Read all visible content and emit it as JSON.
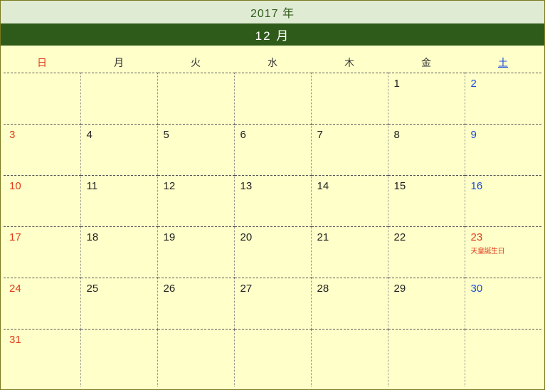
{
  "year_label": "2017 年",
  "month_label": "12 月",
  "weekdays": [
    "日",
    "月",
    "火",
    "水",
    "木",
    "金",
    "土"
  ],
  "weeks": [
    [
      null,
      null,
      null,
      null,
      null,
      {
        "d": "1"
      },
      {
        "d": "2",
        "cls": "sat"
      }
    ],
    [
      {
        "d": "3",
        "cls": "sun"
      },
      {
        "d": "4"
      },
      {
        "d": "5"
      },
      {
        "d": "6"
      },
      {
        "d": "7"
      },
      {
        "d": "8"
      },
      {
        "d": "9",
        "cls": "sat"
      }
    ],
    [
      {
        "d": "10",
        "cls": "sun"
      },
      {
        "d": "11"
      },
      {
        "d": "12"
      },
      {
        "d": "13"
      },
      {
        "d": "14"
      },
      {
        "d": "15"
      },
      {
        "d": "16",
        "cls": "sat"
      }
    ],
    [
      {
        "d": "17",
        "cls": "sun"
      },
      {
        "d": "18"
      },
      {
        "d": "19"
      },
      {
        "d": "20"
      },
      {
        "d": "21"
      },
      {
        "d": "22"
      },
      {
        "d": "23",
        "cls": "holiday",
        "holiday": "天皇誕生日"
      }
    ],
    [
      {
        "d": "24",
        "cls": "sun"
      },
      {
        "d": "25"
      },
      {
        "d": "26"
      },
      {
        "d": "27"
      },
      {
        "d": "28"
      },
      {
        "d": "29"
      },
      {
        "d": "30",
        "cls": "sat"
      }
    ],
    [
      {
        "d": "31",
        "cls": "sun"
      },
      null,
      null,
      null,
      null,
      null,
      null
    ]
  ]
}
